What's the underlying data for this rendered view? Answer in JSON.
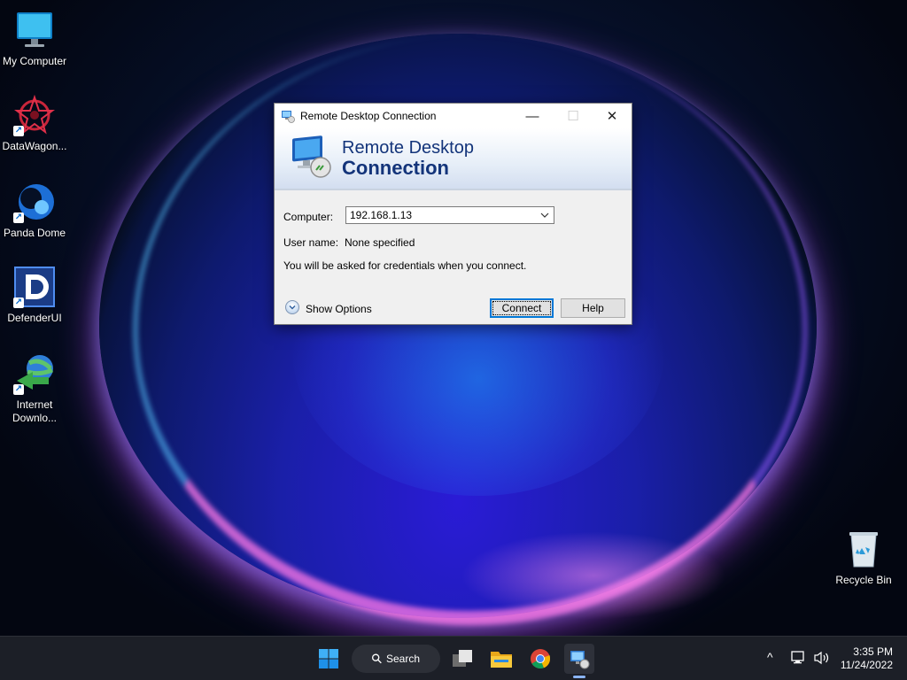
{
  "desktop": {
    "icons": [
      {
        "label": "My Computer",
        "icon": "monitor-icon"
      },
      {
        "label": "DataWagon...",
        "icon": "datawagon-icon"
      },
      {
        "label": "Panda Dome",
        "icon": "panda-dome-icon"
      },
      {
        "label": "DefenderUI",
        "icon": "defenderui-icon"
      },
      {
        "label": "Internet\nDownlo...",
        "icon": "internet-download-manager-icon"
      }
    ],
    "recycle_bin": {
      "label": "Recycle Bin",
      "icon": "recycle-bin-icon"
    },
    "shortcut_glyph": "↗"
  },
  "dialog": {
    "title": "Remote Desktop Connection",
    "banner_line1": "Remote Desktop",
    "banner_line2": "Connection",
    "computer_label": "Computer:",
    "computer_value": "192.168.1.13",
    "username_label": "User name:",
    "username_value": "None specified",
    "info_text": "You will be asked for credentials when you connect.",
    "show_options_label": "Show Options",
    "connect_label": "Connect",
    "help_label": "Help",
    "minimize_glyph": "—",
    "maximize_glyph": "☐",
    "close_glyph": "✕"
  },
  "taskbar": {
    "search_label": "Search",
    "search_glyph": "⚲",
    "tray_chevron": "^",
    "time": "3:35 PM",
    "date": "11/24/2022",
    "colors": {
      "accent": "#0078d7",
      "taskbar": "#1c1f27"
    }
  }
}
